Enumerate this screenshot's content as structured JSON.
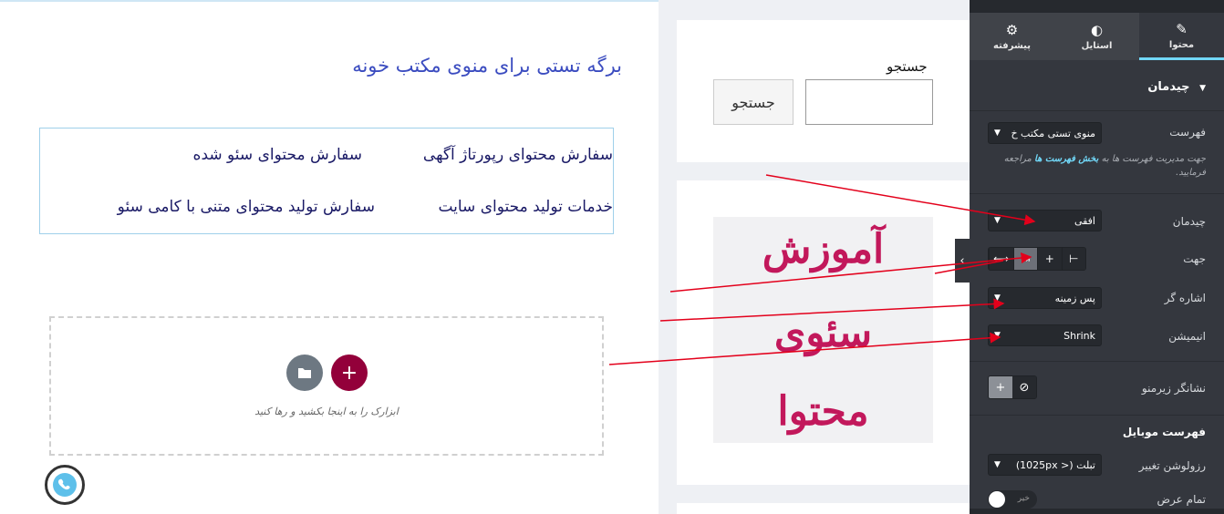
{
  "page": {
    "title": "برگه تستی برای منوی مکتب خونه"
  },
  "menu": {
    "items": [
      "سفارش محتوای رپورتاژ آگهی",
      "سفارش محتوای سئو شده",
      "خدمات تولید محتوای سایت",
      "سفارش تولید محتوای متنی با کامی سئو"
    ]
  },
  "dropzone": {
    "text": "ابزارک را به اینجا بکشید و رها کنید",
    "add_icon": "+",
    "folder_icon": "folder-icon"
  },
  "search_widget": {
    "label": "جستجو",
    "button_label": "جستجو"
  },
  "image_widget": {
    "lines": [
      "آموزش",
      "سئوی",
      "محتوا"
    ]
  },
  "panel": {
    "tabs": [
      {
        "label": "محتوا",
        "icon": "✎"
      },
      {
        "label": "استایل",
        "icon": "◐"
      },
      {
        "label": "پیشرفته",
        "icon": "⚙"
      }
    ],
    "section_title": "چیدمان",
    "menu_label": "فهرست",
    "menu_value": "منوی تستی مکتب خ",
    "desc_prefix": "جهت مدیریت فهرست ها به",
    "desc_link": "بخش فهرست ها",
    "desc_suffix": "مراجعه فرمایید.",
    "layout_label": "چیدمان",
    "layout_value": "افقی",
    "direction_label": "جهت",
    "pointer_label": "اشاره گر",
    "pointer_value": "پس زمینه",
    "animation_label": "انیمیشن",
    "animation_value": "Shrink",
    "submenu_indicator_label": "نشانگر زیرمنو",
    "mobile_section": "فهرست موبایل",
    "breakpoint_label": "رزولوشن تغییر",
    "breakpoint_value": "تبلت (< 1025px)",
    "full_width_label": "تمام عرض",
    "full_width_value": "خیر"
  },
  "colors": {
    "panel_bg": "#34373e",
    "accent": "#71d7f7",
    "add_button": "#93003a",
    "image_text": "#c2185b",
    "arrow": "#e3001b"
  }
}
